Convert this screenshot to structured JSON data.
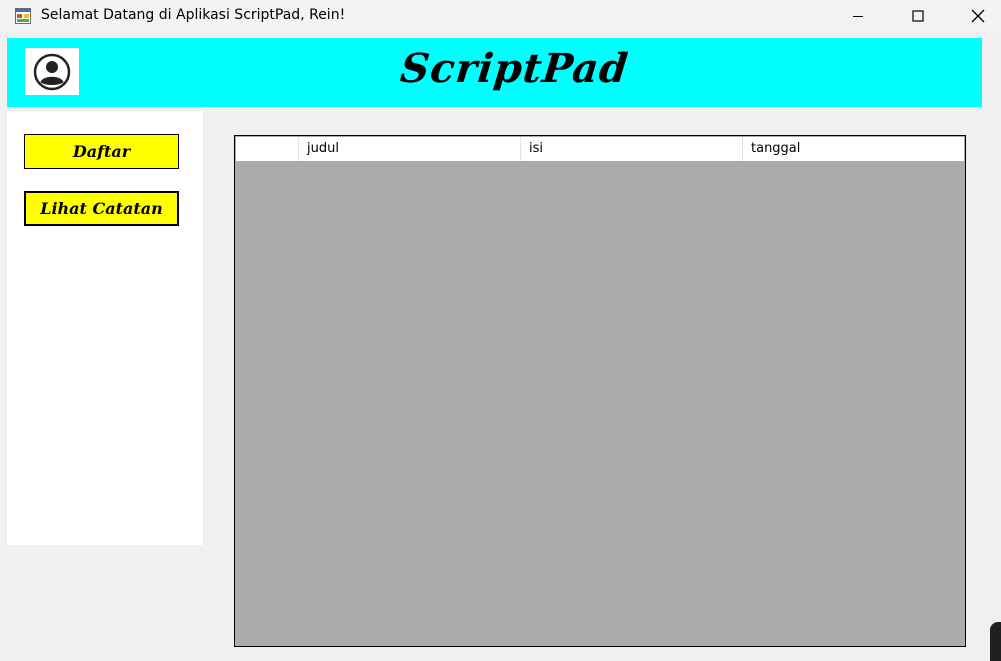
{
  "window": {
    "title": "Selamat Datang di Aplikasi ScriptPad, Rein!",
    "icon": "app-form-icon",
    "controls": [
      "minimize-icon",
      "maximize-icon",
      "close-icon"
    ]
  },
  "header": {
    "brand": "ScriptPad",
    "background": "#00ffff",
    "avatar_icon": "user-circle-icon"
  },
  "sidebar": {
    "buttons": [
      {
        "label": "Daftar"
      },
      {
        "label": "Lihat Catatan"
      }
    ],
    "button_color": "#ffff00"
  },
  "grid": {
    "columns": [
      "",
      "judul",
      "isi",
      "tanggal"
    ],
    "rows": [],
    "background": "#ababab"
  }
}
